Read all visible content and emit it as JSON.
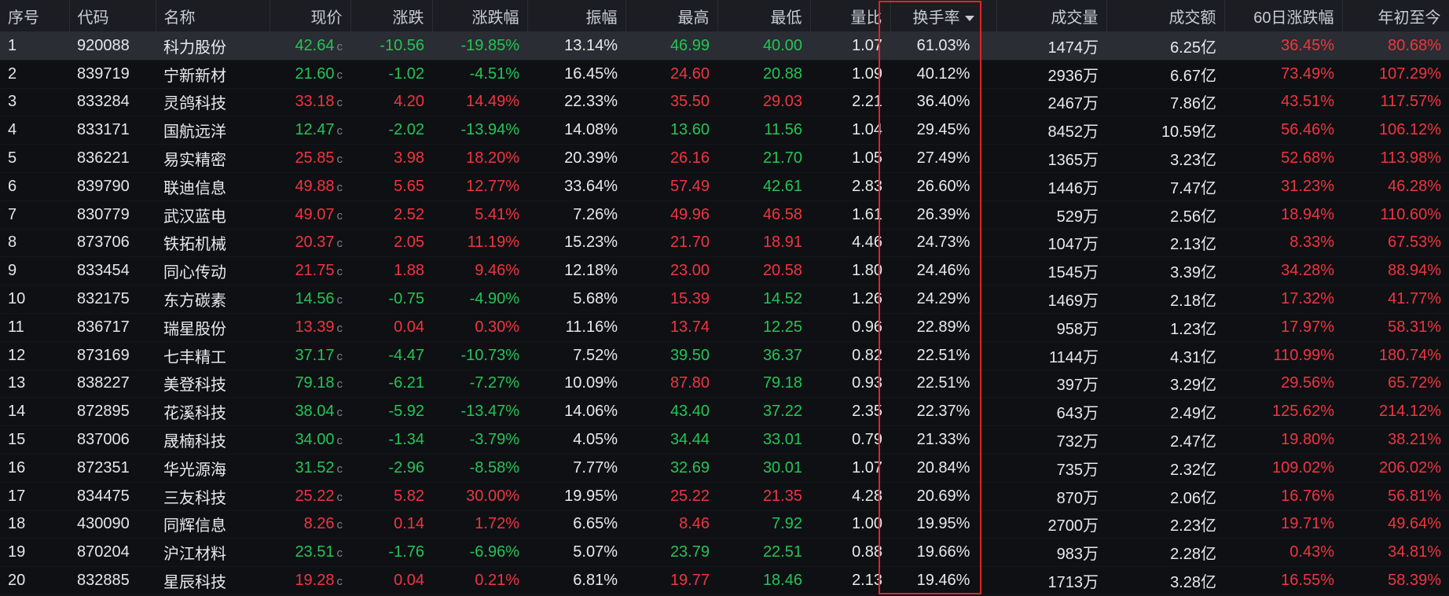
{
  "colors": {
    "up": "#f0353f",
    "down": "#24c455",
    "header_bg": "#1b1d22",
    "highlight": "#e02424"
  },
  "table": {
    "columns": [
      "序号",
      "代码",
      "名称",
      "现价",
      "涨跌",
      "涨跌幅",
      "振幅",
      "最高",
      "最低",
      "量比",
      "换手率",
      "成交量",
      "成交额",
      "60日涨跌幅",
      "年初至今"
    ],
    "sorted_column": "换手率",
    "sort_direction": "desc",
    "price_tag": "c",
    "rows": [
      {
        "idx": "1",
        "code": "920088",
        "name": "科力股份",
        "price": "42.64",
        "chg": "-10.56",
        "pct": "-19.85%",
        "amp": "13.14%",
        "high": "46.99",
        "low": "40.00",
        "vr": "1.07",
        "turn": "61.03%",
        "vol": "1474万",
        "amt": "6.25亿",
        "d60": "36.45%",
        "ytd": "80.68%",
        "price_c": "down",
        "chg_c": "down",
        "high_c": "down",
        "low_c": "down",
        "d60_c": "up",
        "ytd_c": "up"
      },
      {
        "idx": "2",
        "code": "839719",
        "name": "宁新新材",
        "price": "21.60",
        "chg": "-1.02",
        "pct": "-4.51%",
        "amp": "16.45%",
        "high": "24.60",
        "low": "20.88",
        "vr": "1.09",
        "turn": "40.12%",
        "vol": "2936万",
        "amt": "6.67亿",
        "d60": "73.49%",
        "ytd": "107.29%",
        "price_c": "down",
        "chg_c": "down",
        "high_c": "up",
        "low_c": "down",
        "d60_c": "up",
        "ytd_c": "up"
      },
      {
        "idx": "3",
        "code": "833284",
        "name": "灵鸽科技",
        "price": "33.18",
        "chg": "4.20",
        "pct": "14.49%",
        "amp": "22.33%",
        "high": "35.50",
        "low": "29.03",
        "vr": "2.21",
        "turn": "36.40%",
        "vol": "2467万",
        "amt": "7.86亿",
        "d60": "43.51%",
        "ytd": "117.57%",
        "price_c": "up",
        "chg_c": "up",
        "high_c": "up",
        "low_c": "up",
        "d60_c": "up",
        "ytd_c": "up"
      },
      {
        "idx": "4",
        "code": "833171",
        "name": "国航远洋",
        "price": "12.47",
        "chg": "-2.02",
        "pct": "-13.94%",
        "amp": "14.08%",
        "high": "13.60",
        "low": "11.56",
        "vr": "1.04",
        "turn": "29.45%",
        "vol": "8452万",
        "amt": "10.59亿",
        "d60": "56.46%",
        "ytd": "106.12%",
        "price_c": "down",
        "chg_c": "down",
        "high_c": "down",
        "low_c": "down",
        "d60_c": "up",
        "ytd_c": "up"
      },
      {
        "idx": "5",
        "code": "836221",
        "name": "易实精密",
        "price": "25.85",
        "chg": "3.98",
        "pct": "18.20%",
        "amp": "20.39%",
        "high": "26.16",
        "low": "21.70",
        "vr": "1.05",
        "turn": "27.49%",
        "vol": "1365万",
        "amt": "3.23亿",
        "d60": "52.68%",
        "ytd": "113.98%",
        "price_c": "up",
        "chg_c": "up",
        "high_c": "up",
        "low_c": "down",
        "d60_c": "up",
        "ytd_c": "up"
      },
      {
        "idx": "6",
        "code": "839790",
        "name": "联迪信息",
        "price": "49.88",
        "chg": "5.65",
        "pct": "12.77%",
        "amp": "33.64%",
        "high": "57.49",
        "low": "42.61",
        "vr": "2.83",
        "turn": "26.60%",
        "vol": "1446万",
        "amt": "7.47亿",
        "d60": "31.23%",
        "ytd": "46.28%",
        "price_c": "up",
        "chg_c": "up",
        "high_c": "up",
        "low_c": "down",
        "d60_c": "up",
        "ytd_c": "up"
      },
      {
        "idx": "7",
        "code": "830779",
        "name": "武汉蓝电",
        "price": "49.07",
        "chg": "2.52",
        "pct": "5.41%",
        "amp": "7.26%",
        "high": "49.96",
        "low": "46.58",
        "vr": "1.61",
        "turn": "26.39%",
        "vol": "529万",
        "amt": "2.56亿",
        "d60": "18.94%",
        "ytd": "110.60%",
        "price_c": "up",
        "chg_c": "up",
        "high_c": "up",
        "low_c": "up",
        "d60_c": "up",
        "ytd_c": "up"
      },
      {
        "idx": "8",
        "code": "873706",
        "name": "铁拓机械",
        "price": "20.37",
        "chg": "2.05",
        "pct": "11.19%",
        "amp": "15.23%",
        "high": "21.70",
        "low": "18.91",
        "vr": "4.46",
        "turn": "24.73%",
        "vol": "1047万",
        "amt": "2.13亿",
        "d60": "8.33%",
        "ytd": "67.53%",
        "price_c": "up",
        "chg_c": "up",
        "high_c": "up",
        "low_c": "up",
        "d60_c": "up",
        "ytd_c": "up"
      },
      {
        "idx": "9",
        "code": "833454",
        "name": "同心传动",
        "price": "21.75",
        "chg": "1.88",
        "pct": "9.46%",
        "amp": "12.18%",
        "high": "23.00",
        "low": "20.58",
        "vr": "1.80",
        "turn": "24.46%",
        "vol": "1545万",
        "amt": "3.39亿",
        "d60": "34.28%",
        "ytd": "88.94%",
        "price_c": "up",
        "chg_c": "up",
        "high_c": "up",
        "low_c": "up",
        "d60_c": "up",
        "ytd_c": "up"
      },
      {
        "idx": "10",
        "code": "832175",
        "name": "东方碳素",
        "price": "14.56",
        "chg": "-0.75",
        "pct": "-4.90%",
        "amp": "5.68%",
        "high": "15.39",
        "low": "14.52",
        "vr": "1.26",
        "turn": "24.29%",
        "vol": "1469万",
        "amt": "2.18亿",
        "d60": "17.32%",
        "ytd": "41.77%",
        "price_c": "down",
        "chg_c": "down",
        "high_c": "up",
        "low_c": "down",
        "d60_c": "up",
        "ytd_c": "up"
      },
      {
        "idx": "11",
        "code": "836717",
        "name": "瑞星股份",
        "price": "13.39",
        "chg": "0.04",
        "pct": "0.30%",
        "amp": "11.16%",
        "high": "13.74",
        "low": "12.25",
        "vr": "0.96",
        "turn": "22.89%",
        "vol": "958万",
        "amt": "1.23亿",
        "d60": "17.97%",
        "ytd": "58.31%",
        "price_c": "up",
        "chg_c": "up",
        "high_c": "up",
        "low_c": "down",
        "d60_c": "up",
        "ytd_c": "up"
      },
      {
        "idx": "12",
        "code": "873169",
        "name": "七丰精工",
        "price": "37.17",
        "chg": "-4.47",
        "pct": "-10.73%",
        "amp": "7.52%",
        "high": "39.50",
        "low": "36.37",
        "vr": "0.82",
        "turn": "22.51%",
        "vol": "1144万",
        "amt": "4.31亿",
        "d60": "110.99%",
        "ytd": "180.74%",
        "price_c": "down",
        "chg_c": "down",
        "high_c": "down",
        "low_c": "down",
        "d60_c": "up",
        "ytd_c": "up"
      },
      {
        "idx": "13",
        "code": "838227",
        "name": "美登科技",
        "price": "79.18",
        "chg": "-6.21",
        "pct": "-7.27%",
        "amp": "10.09%",
        "high": "87.80",
        "low": "79.18",
        "vr": "0.93",
        "turn": "22.51%",
        "vol": "397万",
        "amt": "3.29亿",
        "d60": "29.56%",
        "ytd": "65.72%",
        "price_c": "down",
        "chg_c": "down",
        "high_c": "up",
        "low_c": "down",
        "d60_c": "up",
        "ytd_c": "up"
      },
      {
        "idx": "14",
        "code": "872895",
        "name": "花溪科技",
        "price": "38.04",
        "chg": "-5.92",
        "pct": "-13.47%",
        "amp": "14.06%",
        "high": "43.40",
        "low": "37.22",
        "vr": "2.35",
        "turn": "22.37%",
        "vol": "643万",
        "amt": "2.49亿",
        "d60": "125.62%",
        "ytd": "214.12%",
        "price_c": "down",
        "chg_c": "down",
        "high_c": "down",
        "low_c": "down",
        "d60_c": "up",
        "ytd_c": "up"
      },
      {
        "idx": "15",
        "code": "837006",
        "name": "晟楠科技",
        "price": "34.00",
        "chg": "-1.34",
        "pct": "-3.79%",
        "amp": "4.05%",
        "high": "34.44",
        "low": "33.01",
        "vr": "0.79",
        "turn": "21.33%",
        "vol": "732万",
        "amt": "2.47亿",
        "d60": "19.80%",
        "ytd": "38.21%",
        "price_c": "down",
        "chg_c": "down",
        "high_c": "down",
        "low_c": "down",
        "d60_c": "up",
        "ytd_c": "up"
      },
      {
        "idx": "16",
        "code": "872351",
        "name": "华光源海",
        "price": "31.52",
        "chg": "-2.96",
        "pct": "-8.58%",
        "amp": "7.77%",
        "high": "32.69",
        "low": "30.01",
        "vr": "1.07",
        "turn": "20.84%",
        "vol": "735万",
        "amt": "2.32亿",
        "d60": "109.02%",
        "ytd": "206.02%",
        "price_c": "down",
        "chg_c": "down",
        "high_c": "down",
        "low_c": "down",
        "d60_c": "up",
        "ytd_c": "up"
      },
      {
        "idx": "17",
        "code": "834475",
        "name": "三友科技",
        "price": "25.22",
        "chg": "5.82",
        "pct": "30.00%",
        "amp": "19.95%",
        "high": "25.22",
        "low": "21.35",
        "vr": "4.28",
        "turn": "20.69%",
        "vol": "870万",
        "amt": "2.06亿",
        "d60": "16.76%",
        "ytd": "56.81%",
        "price_c": "up",
        "chg_c": "up",
        "high_c": "up",
        "low_c": "up",
        "d60_c": "up",
        "ytd_c": "up"
      },
      {
        "idx": "18",
        "code": "430090",
        "name": "同辉信息",
        "price": "8.26",
        "chg": "0.14",
        "pct": "1.72%",
        "amp": "6.65%",
        "high": "8.46",
        "low": "7.92",
        "vr": "1.00",
        "turn": "19.95%",
        "vol": "2700万",
        "amt": "2.23亿",
        "d60": "19.71%",
        "ytd": "49.64%",
        "price_c": "up",
        "chg_c": "up",
        "high_c": "up",
        "low_c": "down",
        "d60_c": "up",
        "ytd_c": "up"
      },
      {
        "idx": "19",
        "code": "870204",
        "name": "沪江材料",
        "price": "23.51",
        "chg": "-1.76",
        "pct": "-6.96%",
        "amp": "5.07%",
        "high": "23.79",
        "low": "22.51",
        "vr": "0.88",
        "turn": "19.66%",
        "vol": "983万",
        "amt": "2.28亿",
        "d60": "0.43%",
        "ytd": "34.81%",
        "price_c": "down",
        "chg_c": "down",
        "high_c": "down",
        "low_c": "down",
        "d60_c": "up",
        "ytd_c": "up"
      },
      {
        "idx": "20",
        "code": "832885",
        "name": "星辰科技",
        "price": "19.28",
        "chg": "0.04",
        "pct": "0.21%",
        "amp": "6.81%",
        "high": "19.77",
        "low": "18.46",
        "vr": "2.13",
        "turn": "19.46%",
        "vol": "1713万",
        "amt": "3.28亿",
        "d60": "16.55%",
        "ytd": "58.39%",
        "price_c": "up",
        "chg_c": "up",
        "high_c": "up",
        "low_c": "down",
        "d60_c": "up",
        "ytd_c": "up"
      }
    ]
  }
}
